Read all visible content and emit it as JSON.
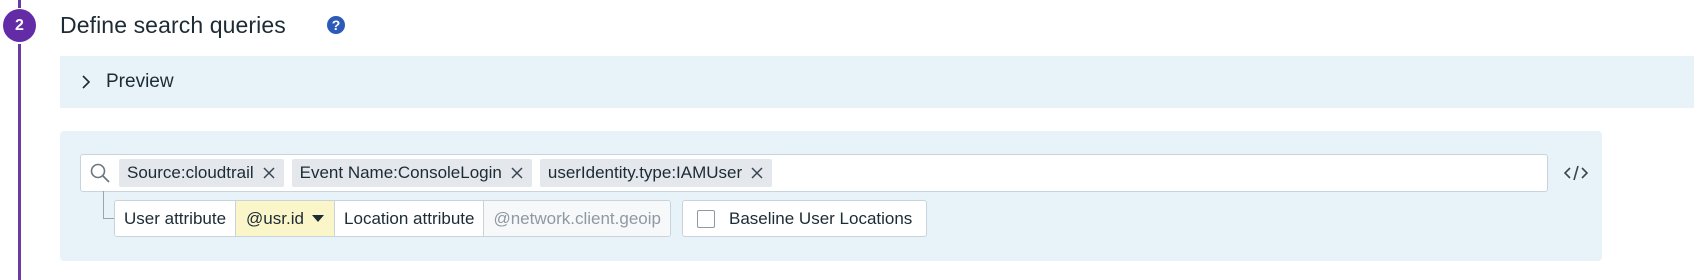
{
  "step": {
    "number": "2",
    "title": "Define search queries",
    "help_icon": "question-circle-icon"
  },
  "preview": {
    "label": "Preview",
    "expanded": false
  },
  "query": {
    "chips": [
      {
        "label": "Source:cloudtrail"
      },
      {
        "label": "Event Name:ConsoleLogin"
      },
      {
        "label": "userIdentity.type:IAMUser"
      }
    ],
    "attributes": {
      "user_attribute_label": "User attribute",
      "user_attribute_value": "@usr.id",
      "location_attribute_label": "Location attribute",
      "location_attribute_placeholder": "@network.client.geoip"
    },
    "baseline": {
      "label": "Baseline User Locations",
      "checked": false
    }
  },
  "colors": {
    "step_badge": "#632ca6",
    "panel_bg": "#e8f2f9",
    "select_highlight": "#fbf6c9",
    "help_icon": "#2b5ab8"
  }
}
